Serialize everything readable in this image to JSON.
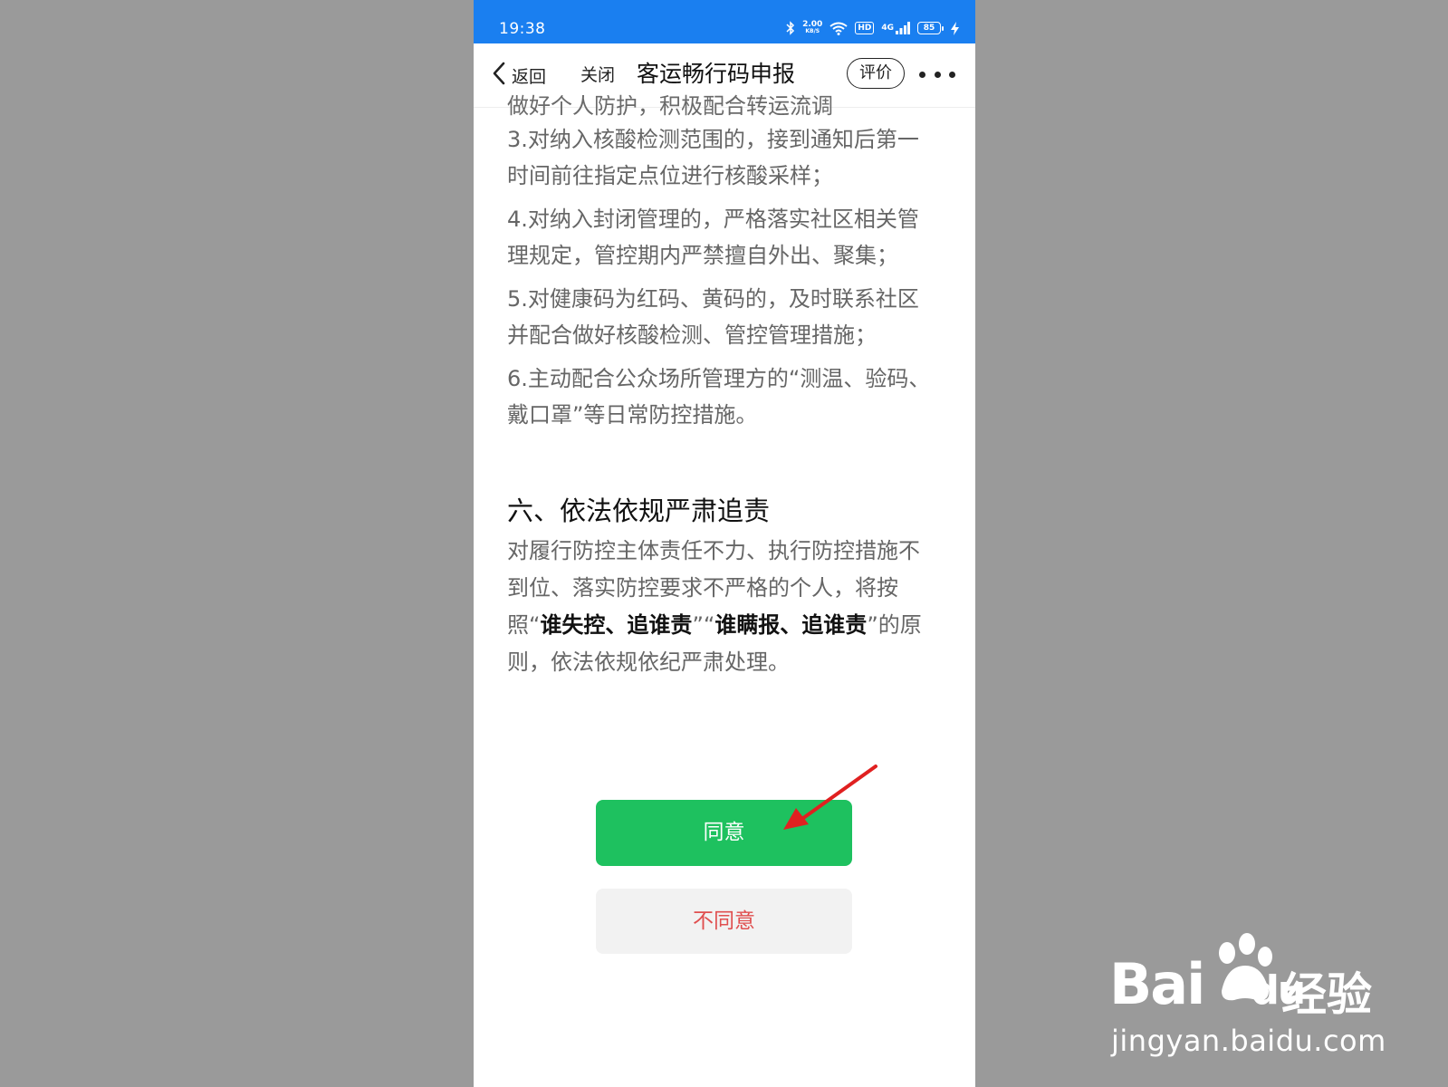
{
  "status_bar": {
    "time": "19:38",
    "net_speed": "2.00",
    "net_unit": "KB/S",
    "hd": "HD",
    "signal_label": "4G",
    "battery": "85"
  },
  "nav": {
    "back_label": "返回",
    "close_label": "关闭",
    "title": "客运畅行码申报",
    "rate_label": "评价"
  },
  "content": {
    "cut_line": "做好个人防护，积极配合转运流调",
    "items": [
      "3.对纳入核酸检测范围的，接到通知后第一时间前往指定点位进行核酸采样；",
      "4.对纳入封闭管理的，严格落实社区相关管理规定，管控期内严禁擅自外出、聚集；",
      "5.对健康码为红码、黄码的，及时联系社区并配合做好核酸检测、管控管理措施；",
      "6.主动配合公众场所管理方的“测温、验码、戴口罩”等日常防控措施。"
    ],
    "section_title": "六、依法依规严肃追责",
    "section_body_1": "对履行防控主体责任不力、执行防控措施不到位、落实防控要求不严格的个人，将按照“",
    "section_body_bold_1": "谁失控、追谁责",
    "section_body_2": "”“",
    "section_body_bold_2": "谁瞒报、追谁责",
    "section_body_3": "”的原则，依法依规依纪严肃处理。"
  },
  "buttons": {
    "agree": "同意",
    "disagree": "不同意"
  },
  "watermark": {
    "brand": "Bai",
    "brand_du": "du",
    "cn": "经验",
    "url": "jingyan.baidu.com"
  },
  "colors": {
    "status_bar": "#1a7ff0",
    "agree": "#1ec15f",
    "disagree_text": "#e04f4f",
    "arrow": "#e02020"
  }
}
